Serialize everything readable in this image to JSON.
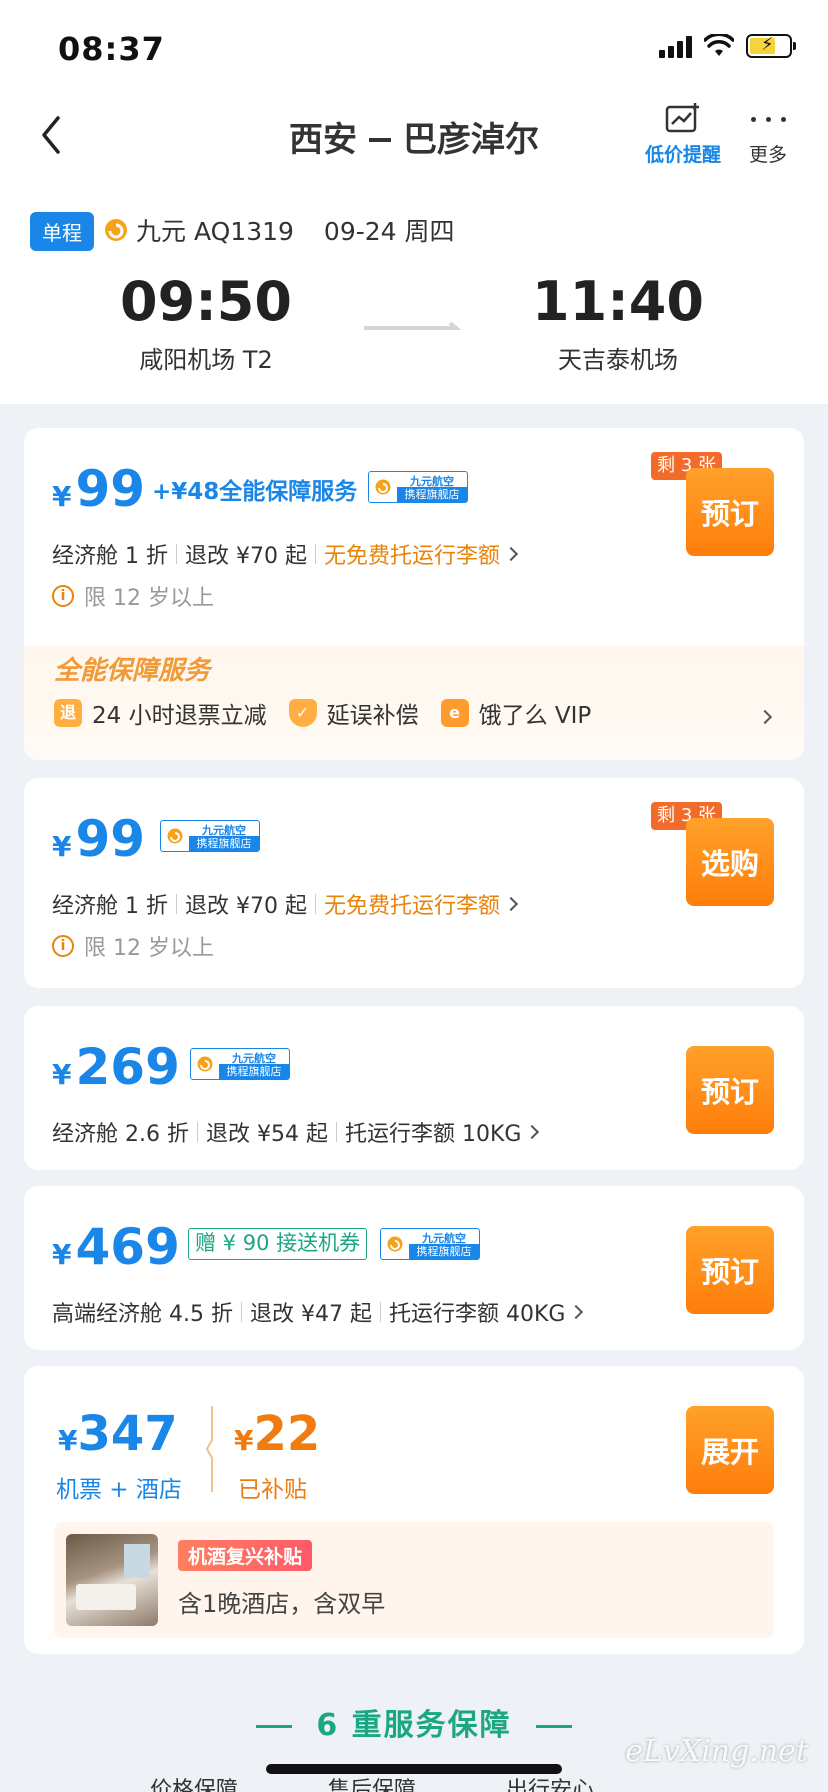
{
  "status": {
    "time": "08:37"
  },
  "nav": {
    "route_from": "西安",
    "route_to": "巴彦淖尔",
    "price_alert_label": "低价提醒",
    "more_label": "更多"
  },
  "flight": {
    "trip_type": "单程",
    "airline_flight": "九元 AQ1319",
    "date": "09-24 周四",
    "dep_time": "09:50",
    "dep_airport": "咸阳机场 T2",
    "arr_time": "11:40",
    "arr_airport": "天吉泰机场"
  },
  "store_tag": {
    "line1": "九元航空",
    "line2": "携程旗舰店"
  },
  "offers": [
    {
      "yen": "¥",
      "price": "99",
      "service": "+¥48全能保障服务",
      "cabin": "经济舱 1 折",
      "change": "退改 ¥70 起",
      "baggage": "无免费托运行李额",
      "age_note": "限 12 岁以上",
      "remaining": "剩 3 张",
      "button": "预订",
      "service_band": {
        "title": "全能保障服务",
        "items": [
          {
            "icon": "退",
            "label": "24 小时退票立减"
          },
          {
            "icon": "盾",
            "label": "延误补偿"
          },
          {
            "icon": "e",
            "label": "饿了么 VIP"
          }
        ]
      }
    },
    {
      "yen": "¥",
      "price": "99",
      "cabin": "经济舱 1 折",
      "change": "退改 ¥70 起",
      "baggage": "无免费托运行李额",
      "age_note": "限 12 岁以上",
      "remaining": "剩 3 张",
      "button": "选购"
    },
    {
      "yen": "¥",
      "price": "269",
      "cabin": "经济舱 2.6 折",
      "change": "退改 ¥54 起",
      "baggage": "托运行李额 10KG",
      "button": "预订"
    },
    {
      "yen": "¥",
      "price": "469",
      "gift": "赠 ¥ 90 接送机券",
      "cabin": "高端经济舱 4.5 折",
      "change": "退改 ¥47 起",
      "baggage": "托运行李额 40KG",
      "button": "预订"
    }
  ],
  "combo": {
    "yen": "¥",
    "price": "347",
    "price_label": "机票 + 酒店",
    "subsidy": "22",
    "subsidy_label": "已补贴",
    "button": "展开",
    "hotel_badge": "机酒复兴补贴",
    "hotel_desc": "含1晚酒店，含双早"
  },
  "guarantee": {
    "title": "6 重服务保障"
  },
  "bottom_peek": [
    "价格保障",
    "售后保障",
    "出行安心"
  ],
  "watermark": "eLvXing.net",
  "colors": {
    "accent_blue": "#1a87e8",
    "orange": "#ff8a1a",
    "green": "#1ba784"
  }
}
